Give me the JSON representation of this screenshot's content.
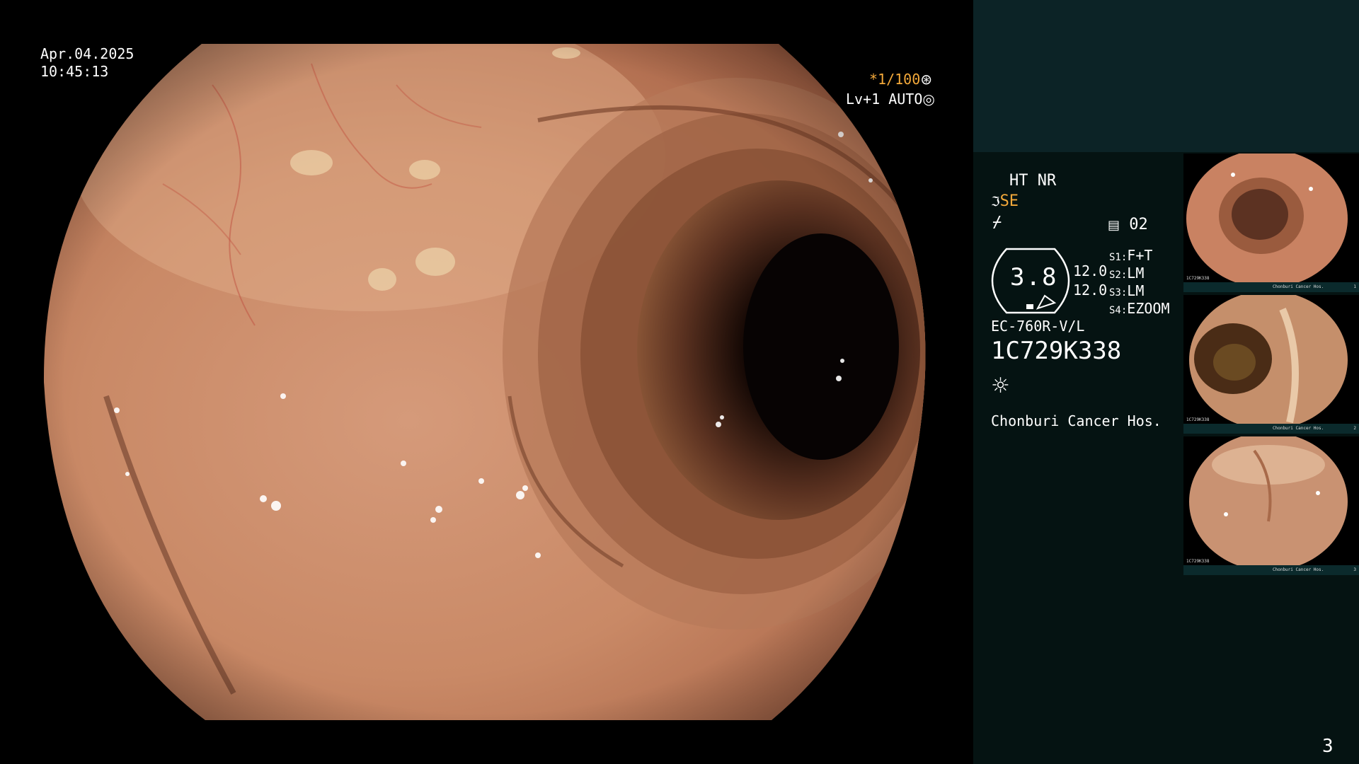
{
  "overlay": {
    "date": "Apr.04.2025",
    "time": "10:45:13",
    "shutter": "*1/100",
    "shutter_icon": "aperture-icon",
    "level": "Lv+1 AUTO",
    "level_icon": "iris-icon"
  },
  "panel": {
    "mode_top": "HT NR",
    "mode_se": "SE",
    "page_num": "02",
    "dial_value": "3.8",
    "side_values": [
      "12.0",
      "12.0"
    ],
    "settings": [
      {
        "key": "S1:",
        "value": "F+T"
      },
      {
        "key": "S2:",
        "value": "LM"
      },
      {
        "key": "S3:",
        "value": "LM"
      },
      {
        "key": "S4:",
        "value": "EZOOM"
      }
    ],
    "scope_model": "EC-760R-V/L",
    "serial": "1C729K338",
    "hospital": "Chonburi Cancer Hos.",
    "page_index": "3"
  },
  "colors": {
    "accent_orange": "#f4a93a",
    "panel_top": "#0c2326",
    "panel_bottom": "#051312"
  },
  "thumbnails": [
    {
      "serial": "1C729K338",
      "hospital": "Chonburi Cancer Hos.",
      "index": "1"
    },
    {
      "serial": "1C729K338",
      "hospital": "Chonburi Cancer Hos.",
      "index": "2"
    },
    {
      "serial": "1C729K338",
      "hospital": "Chonburi Cancer Hos.",
      "index": "3"
    }
  ]
}
